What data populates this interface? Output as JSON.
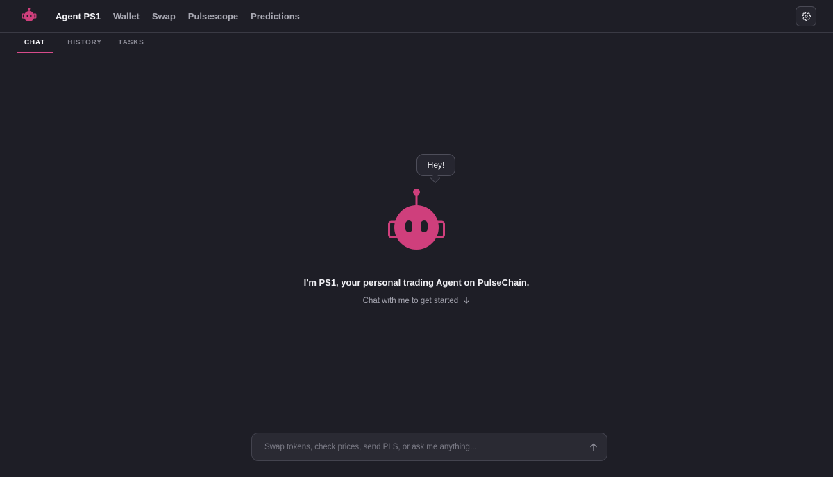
{
  "nav": {
    "items": [
      {
        "label": "Agent PS1",
        "active": true
      },
      {
        "label": "Wallet",
        "active": false
      },
      {
        "label": "Swap",
        "active": false
      },
      {
        "label": "Pulsescope",
        "active": false
      },
      {
        "label": "Predictions",
        "active": false
      }
    ]
  },
  "tabs": [
    {
      "label": "CHAT",
      "active": true
    },
    {
      "label": "HISTORY",
      "active": false
    },
    {
      "label": "TASKS",
      "active": false
    }
  ],
  "hero": {
    "bubble_text": "Hey!",
    "headline": "I'm PS1, your personal trading Agent on PulseChain.",
    "subline": "Chat with me to get started",
    "subline_icon": "arrow-down-icon"
  },
  "composer": {
    "placeholder": "Swap tokens, check prices, send PLS, or ask me anything...",
    "value": "",
    "send_icon": "arrow-up-icon"
  },
  "icons": {
    "logo": "robot-logo-icon",
    "settings": "gear-icon"
  },
  "colors": {
    "background": "#1e1e26",
    "accent": "#d84b8b",
    "robot": "#cf3f7c"
  }
}
